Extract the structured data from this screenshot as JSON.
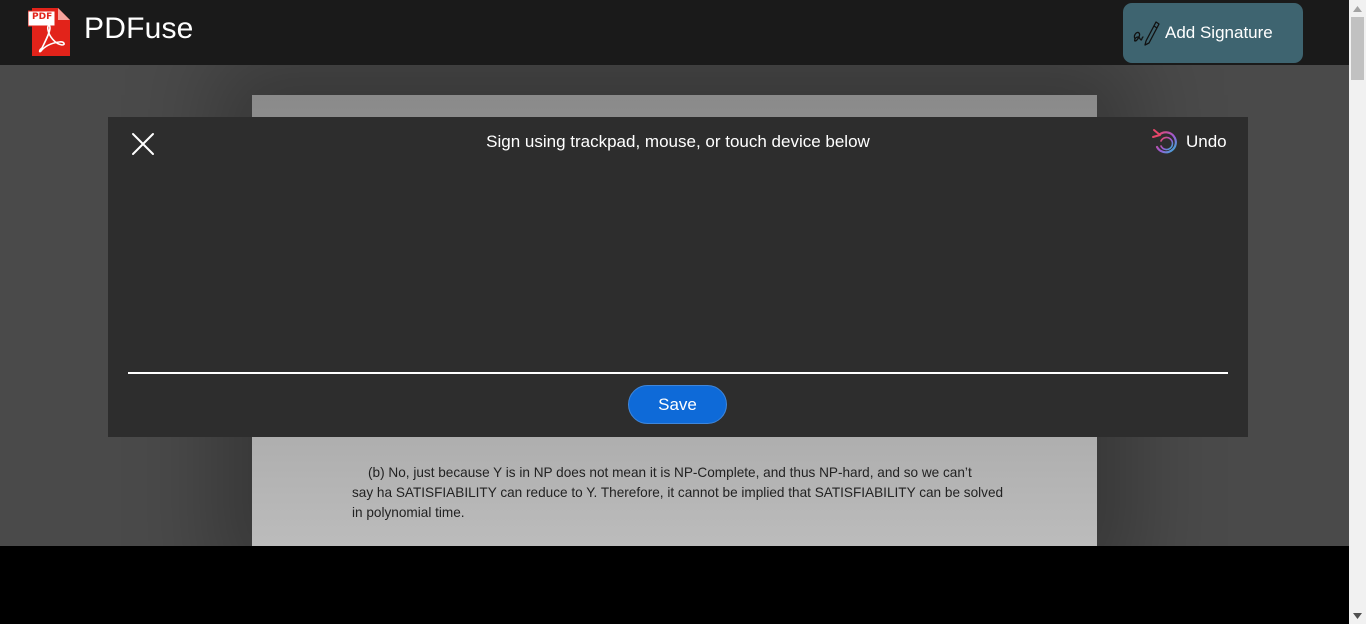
{
  "app": {
    "brand": "PDFuse",
    "logo_badge": "PDF",
    "logo_icon": "pdf-file-icon"
  },
  "toolbar": {
    "add_signature_label": "Add Signature",
    "add_signature_icon": "signature-pen-icon",
    "button_color": "#3e6470"
  },
  "document": {
    "lines": [
      "(b) No, just because Y is in NP does not mean it is NP-Complete, and thus NP-hard, and so we can’t",
      "say ha SATISFIABILITY can reduce to Y. Therefore, it cannot be implied that SATISFIABILITY can be solved",
      "in polynomial time."
    ]
  },
  "signature_modal": {
    "title": "Sign using trackpad, mouse, or touch device below",
    "close_icon": "close-icon",
    "undo_label": "Undo",
    "undo_icon": "undo-icon",
    "save_label": "Save",
    "save_color": "#0e6ad8"
  },
  "scrollbar": {
    "up_icon": "scroll-up-arrow-icon",
    "down_icon": "scroll-down-arrow-icon"
  }
}
